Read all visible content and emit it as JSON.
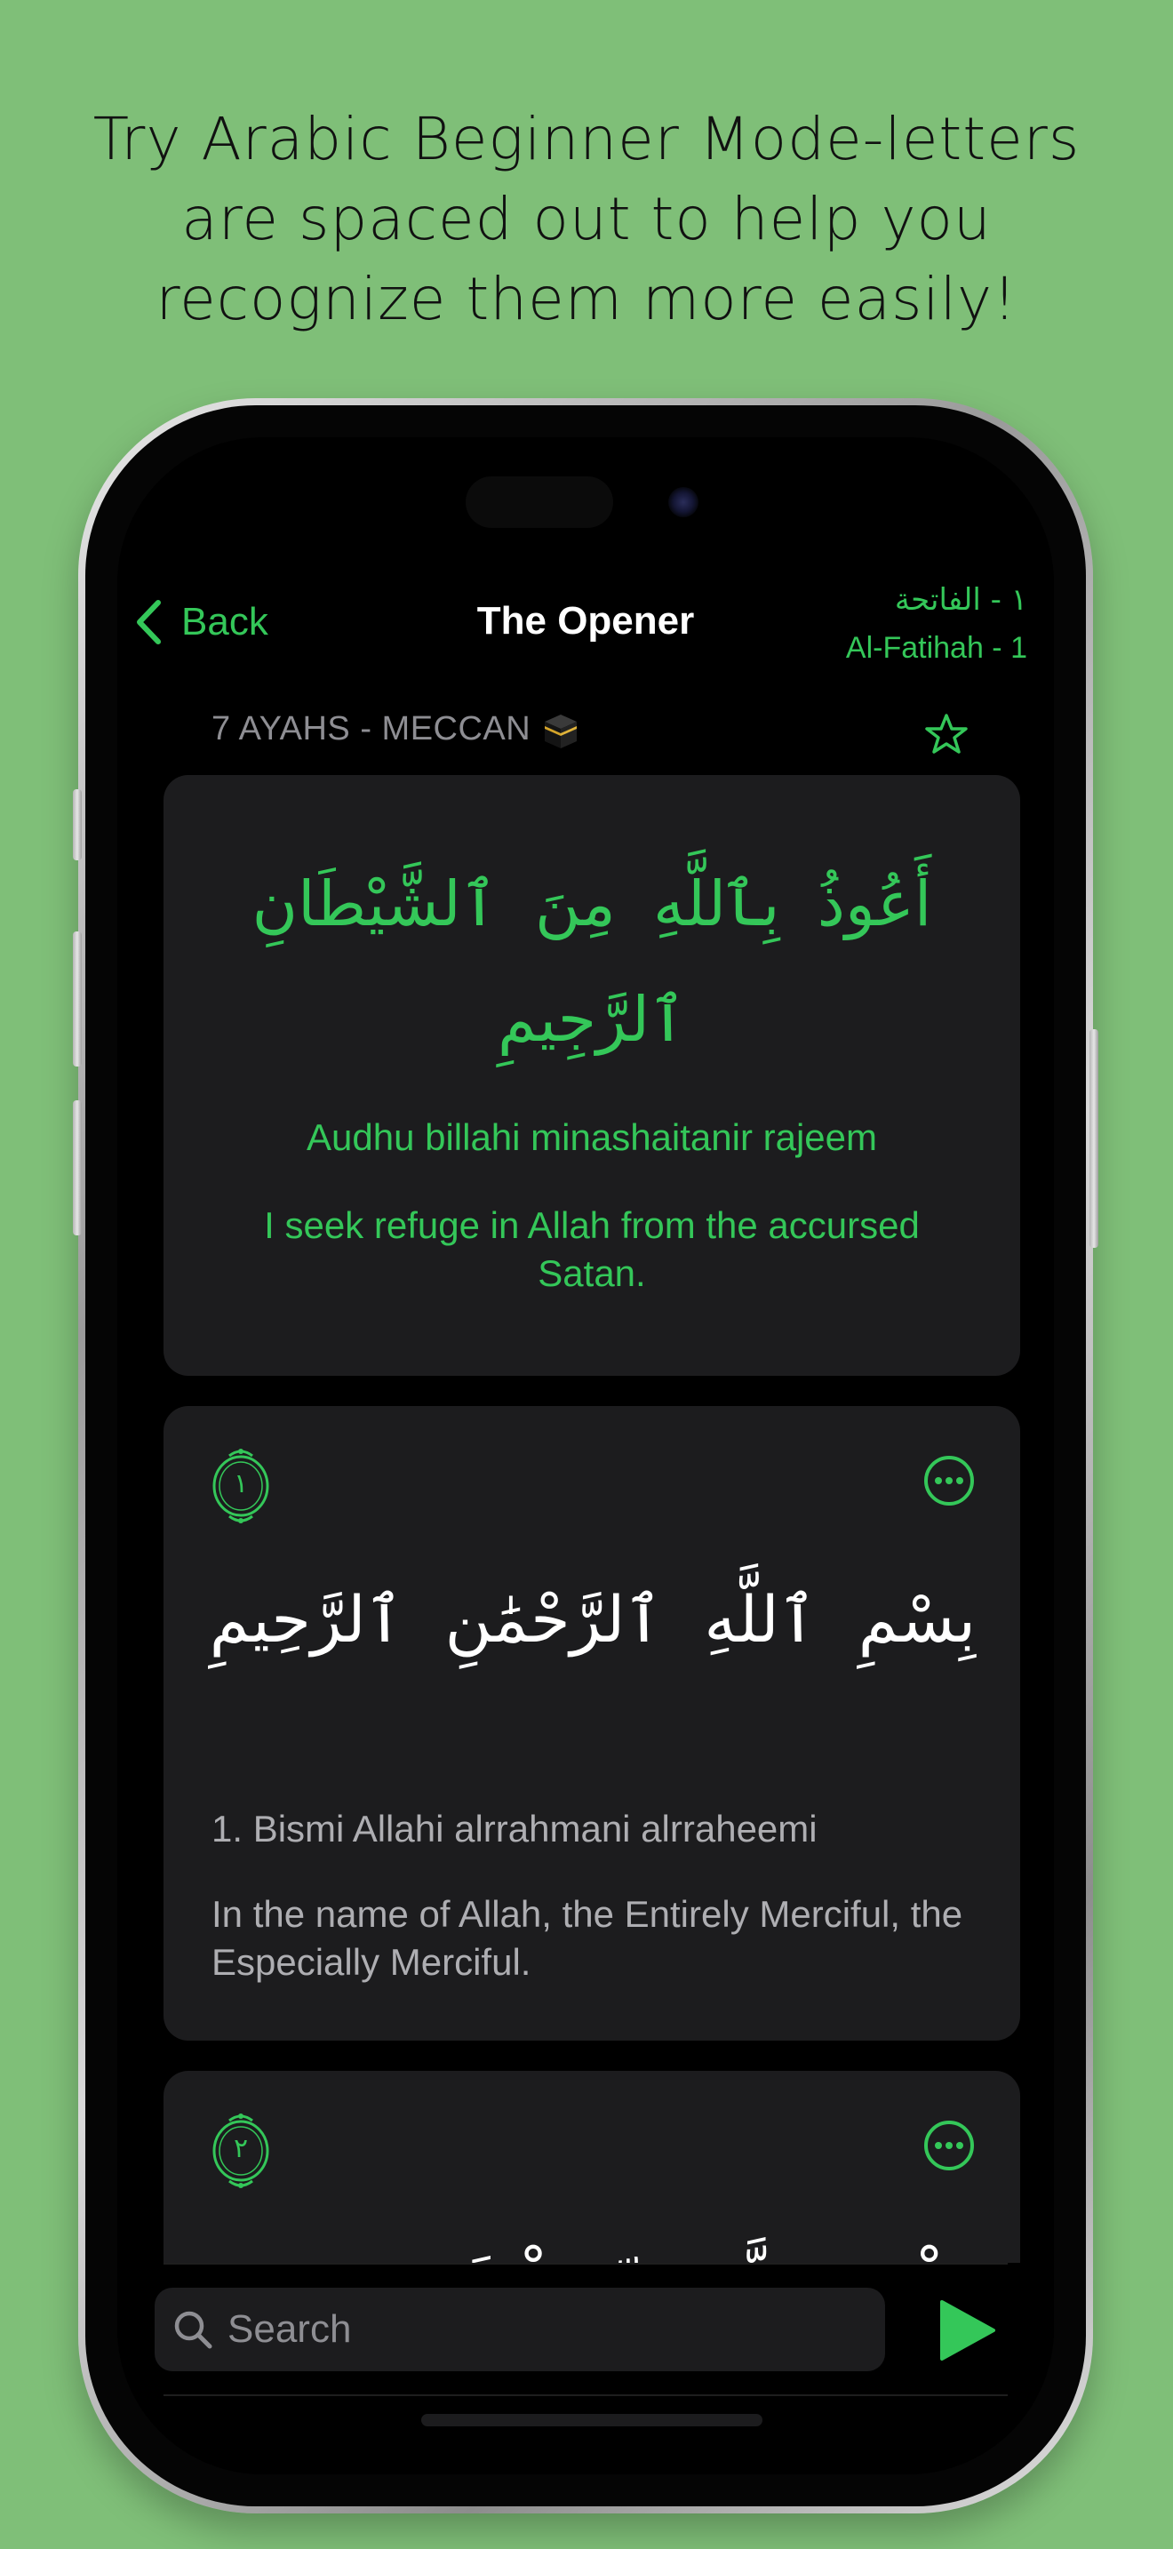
{
  "promo": {
    "headline": "Try Arabic Beginner Mode-letters are spaced out to help you recognize them more easily!"
  },
  "nav": {
    "back_label": "Back",
    "title": "The Opener",
    "surah_arabic": "١ - الفاتحة",
    "surah_latin": "Al-Fatihah - 1"
  },
  "surah_meta": {
    "info": "7 AYAHS - MECCAN"
  },
  "preface": {
    "arabic": "أَعُوذُ بِٱللَّهِ مِنَ ٱلشَّيْطَانِ ٱلرَّجِيمِ",
    "transliteration": "Audhu billahi minashaitanir rajeem",
    "translation": "I seek refuge in Allah from the accursed Satan."
  },
  "ayahs": [
    {
      "number_arabic": "١",
      "arabic": "بِسْمِ ٱللَّهِ ٱلرَّحْمَٰنِ ٱلرَّحِيمِ",
      "transliteration": "1. Bismi Allahi alrrahmani alrraheemi",
      "translation": "In the name of Allah, the Entirely Merciful, the Especially Merciful."
    },
    {
      "number_arabic": "٢",
      "arabic": "ٱلْحَمْدُ لِلَّهِ رَبِّ ٱلْعَٰلَمِينَ"
    }
  ],
  "search": {
    "placeholder": "Search"
  },
  "colors": {
    "background": "#7fbf78",
    "accent": "#34c759",
    "card": "#1c1c1e"
  }
}
